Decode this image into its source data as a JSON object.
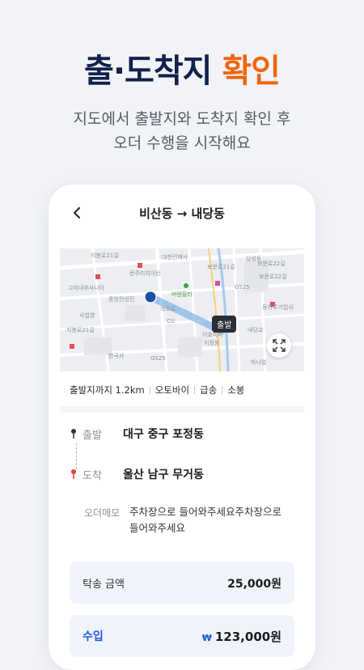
{
  "headline": {
    "part1": "출·도착지 ",
    "part2": "확인"
  },
  "subline": {
    "line1": "지도에서 출발지와 도착지 확인 후",
    "line2": "오더 수행을 시작해요"
  },
  "screen": {
    "route_title": "비산동 → 내당동",
    "map": {
      "start_pin_label": "출발",
      "labels": [
        "지봉로21길",
        "대한건재사",
        "보문로21길",
        "보문로22길",
        "고지내추사나이",
        "문주리치이탄",
        "중앙전성진",
        "버텐필라",
        "와조로",
        "GS25",
        "CU",
        "이호미미",
        "지정동",
        "당성동",
        "보문로22길",
        "동아루기업사",
        "내당교",
        "사업향",
        "한국사",
        "GS25",
        "지봉로21길",
        "하나얼"
      ]
    },
    "info": {
      "distance": "출발지까지 1.2km",
      "vehicle": "오토바이",
      "speed": "급송",
      "size": "소봉"
    },
    "route": {
      "start_label": "출발",
      "start_value": "대구 중구 포정동",
      "end_label": "도착",
      "end_value": "울산 남구 무거동"
    },
    "memo": {
      "label": "오더메모",
      "value": "주차장으로 들어와주세요주차장으로 들어와주세요"
    },
    "fare": {
      "label": "탁송 금액",
      "value": "25,000원"
    },
    "income": {
      "label": "수입",
      "currency": "₩",
      "value": "123,000원"
    }
  },
  "colors": {
    "accent": "#f0650f",
    "navy": "#12204a",
    "blue": "#1d5bd6"
  }
}
